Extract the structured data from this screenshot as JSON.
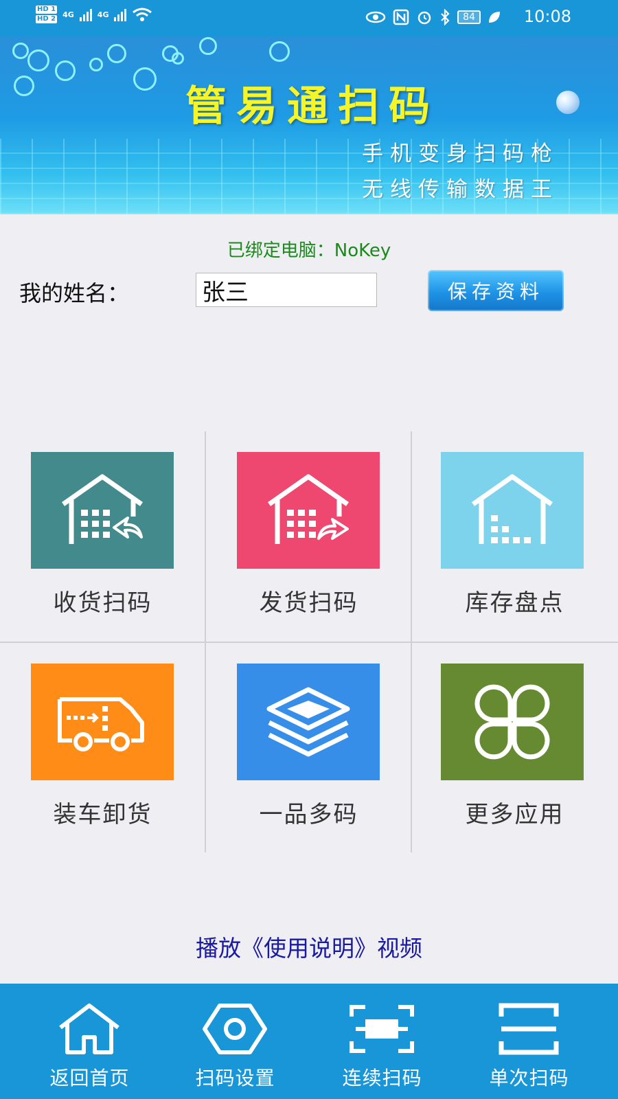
{
  "status_bar": {
    "sim1": "HD 1",
    "sim2": "HD 2",
    "net1": "4G",
    "net2": "4G",
    "battery": "84",
    "time": "10:08"
  },
  "banner": {
    "title": "管易通扫码",
    "subtitle1": "手机变身扫码枪",
    "subtitle2": "无线传输数据王"
  },
  "bound_pc": {
    "label": "已绑定电脑：",
    "value": "NoKey"
  },
  "profile": {
    "name_label": "我的姓名：",
    "name_value": "张三",
    "save_label": "保存资料"
  },
  "apps": [
    {
      "label": "收货扫码",
      "color": "#438a8c",
      "icon": "warehouse-receive-icon"
    },
    {
      "label": "发货扫码",
      "color": "#ee4870",
      "icon": "warehouse-ship-icon"
    },
    {
      "label": "库存盘点",
      "color": "#7dd2ec",
      "icon": "warehouse-inventory-icon"
    },
    {
      "label": "装车卸货",
      "color": "#ff8c16",
      "icon": "truck-loading-icon"
    },
    {
      "label": "一品多码",
      "color": "#368ee8",
      "icon": "layers-icon"
    },
    {
      "label": "更多应用",
      "color": "#658a31",
      "icon": "clover-icon"
    }
  ],
  "video_link": "播放《使用说明》视频",
  "bottom_nav": [
    {
      "label": "返回首页",
      "icon": "home-icon"
    },
    {
      "label": "扫码设置",
      "icon": "hex-nut-icon"
    },
    {
      "label": "连续扫码",
      "icon": "continuous-scan-icon"
    },
    {
      "label": "单次扫码",
      "icon": "single-scan-icon"
    }
  ],
  "colors": {
    "primary": "#1896d8",
    "title_yellow": "#f5f52a",
    "bound_green": "#1a8a1a",
    "link_blue": "#1a1aa0"
  }
}
